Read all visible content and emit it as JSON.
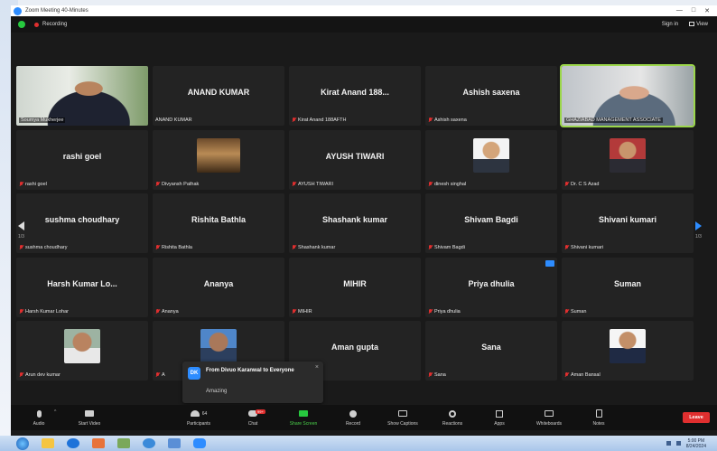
{
  "window": {
    "title": "Zoom Meeting 40-Minutes"
  },
  "titlebar_controls": [
    "—",
    "□",
    "✕"
  ],
  "topbar": {
    "recording_label": "Recording",
    "signin_label": "Sign in",
    "view_label": "View"
  },
  "tiles": [
    {
      "big": "",
      "tag": "Soumya Mukherjee",
      "muted": false,
      "video": "man-suit"
    },
    {
      "big": "ANAND KUMAR",
      "tag": "ANAND KUMAR",
      "muted": false
    },
    {
      "big": "Kirat Anand 188...",
      "tag": "Kirat Anand 188AFTH",
      "muted": true
    },
    {
      "big": "Ashish saxena",
      "tag": "Ashish saxena",
      "muted": true
    },
    {
      "big": "",
      "tag": "GHAZIABAD MANAGEMENT ASSOCIATE",
      "muted": false,
      "video": "older-man",
      "active": true
    },
    {
      "big": "rashi goel",
      "tag": "rashi goel",
      "muted": true
    },
    {
      "big": "",
      "tag": "Divyansh Pathak",
      "muted": true,
      "avatar": "room"
    },
    {
      "big": "AYUSH TIWARI",
      "tag": "AYUSH TIWARI",
      "muted": true
    },
    {
      "big": "",
      "tag": "dinesh singhal",
      "muted": true,
      "avatar": "portrait-white"
    },
    {
      "big": "",
      "tag": "Dr. C S Azad",
      "muted": true,
      "avatar": "portrait-red"
    },
    {
      "big": "sushma choudhary",
      "tag": "sushma choudhary",
      "muted": true
    },
    {
      "big": "Rishita Bathla",
      "tag": "Rishita Bathla",
      "muted": true
    },
    {
      "big": "Shashank kumar",
      "tag": "Shashank kumar",
      "muted": true
    },
    {
      "big": "Shivam Bagdi",
      "tag": "Shivam Bagdi",
      "muted": true
    },
    {
      "big": "Shivani kumari",
      "tag": "Shivani kumari",
      "muted": true
    },
    {
      "big": "Harsh Kumar Lo...",
      "tag": "Harsh Kumar Lohar",
      "muted": true
    },
    {
      "big": "Ananya",
      "tag": "Ananya",
      "muted": true
    },
    {
      "big": "MIHIR",
      "tag": "MIHIR",
      "muted": true
    },
    {
      "big": "Priya dhulia",
      "tag": "Priya dhulia",
      "muted": true,
      "badge": true
    },
    {
      "big": "Suman",
      "tag": "Suman",
      "muted": true
    },
    {
      "big": "",
      "tag": "Arun dev kumar",
      "muted": true,
      "avatar": "portrait-outdoor"
    },
    {
      "big": "",
      "tag": "A",
      "muted": true,
      "avatar": "portrait-blue"
    },
    {
      "big": "Aman gupta",
      "tag": "an gupta",
      "muted": false
    },
    {
      "big": "Sana",
      "tag": "Sana",
      "muted": true
    },
    {
      "big": "",
      "tag": "Aman Bansal",
      "muted": true,
      "avatar": "portrait-suit"
    }
  ],
  "pager": {
    "left": "1/3",
    "right": "1/3"
  },
  "chat_popup": {
    "initials": "DK",
    "from": "From Divuo Karanwal to Everyone",
    "message": "Amazing"
  },
  "toolbar": {
    "audio": "Audio",
    "video": "Start Video",
    "participants": "Participants",
    "participants_count": "64",
    "chat": "Chat",
    "chat_badge": "99+",
    "share": "Share Screen",
    "record": "Record",
    "captions": "Show Captions",
    "reactions": "Reactions",
    "apps": "Apps",
    "whiteboards": "Whiteboards",
    "notes": "Notes",
    "leave": "Leave"
  },
  "taskbar": {
    "time": "5:00 PM",
    "date": "8/24/2024"
  }
}
